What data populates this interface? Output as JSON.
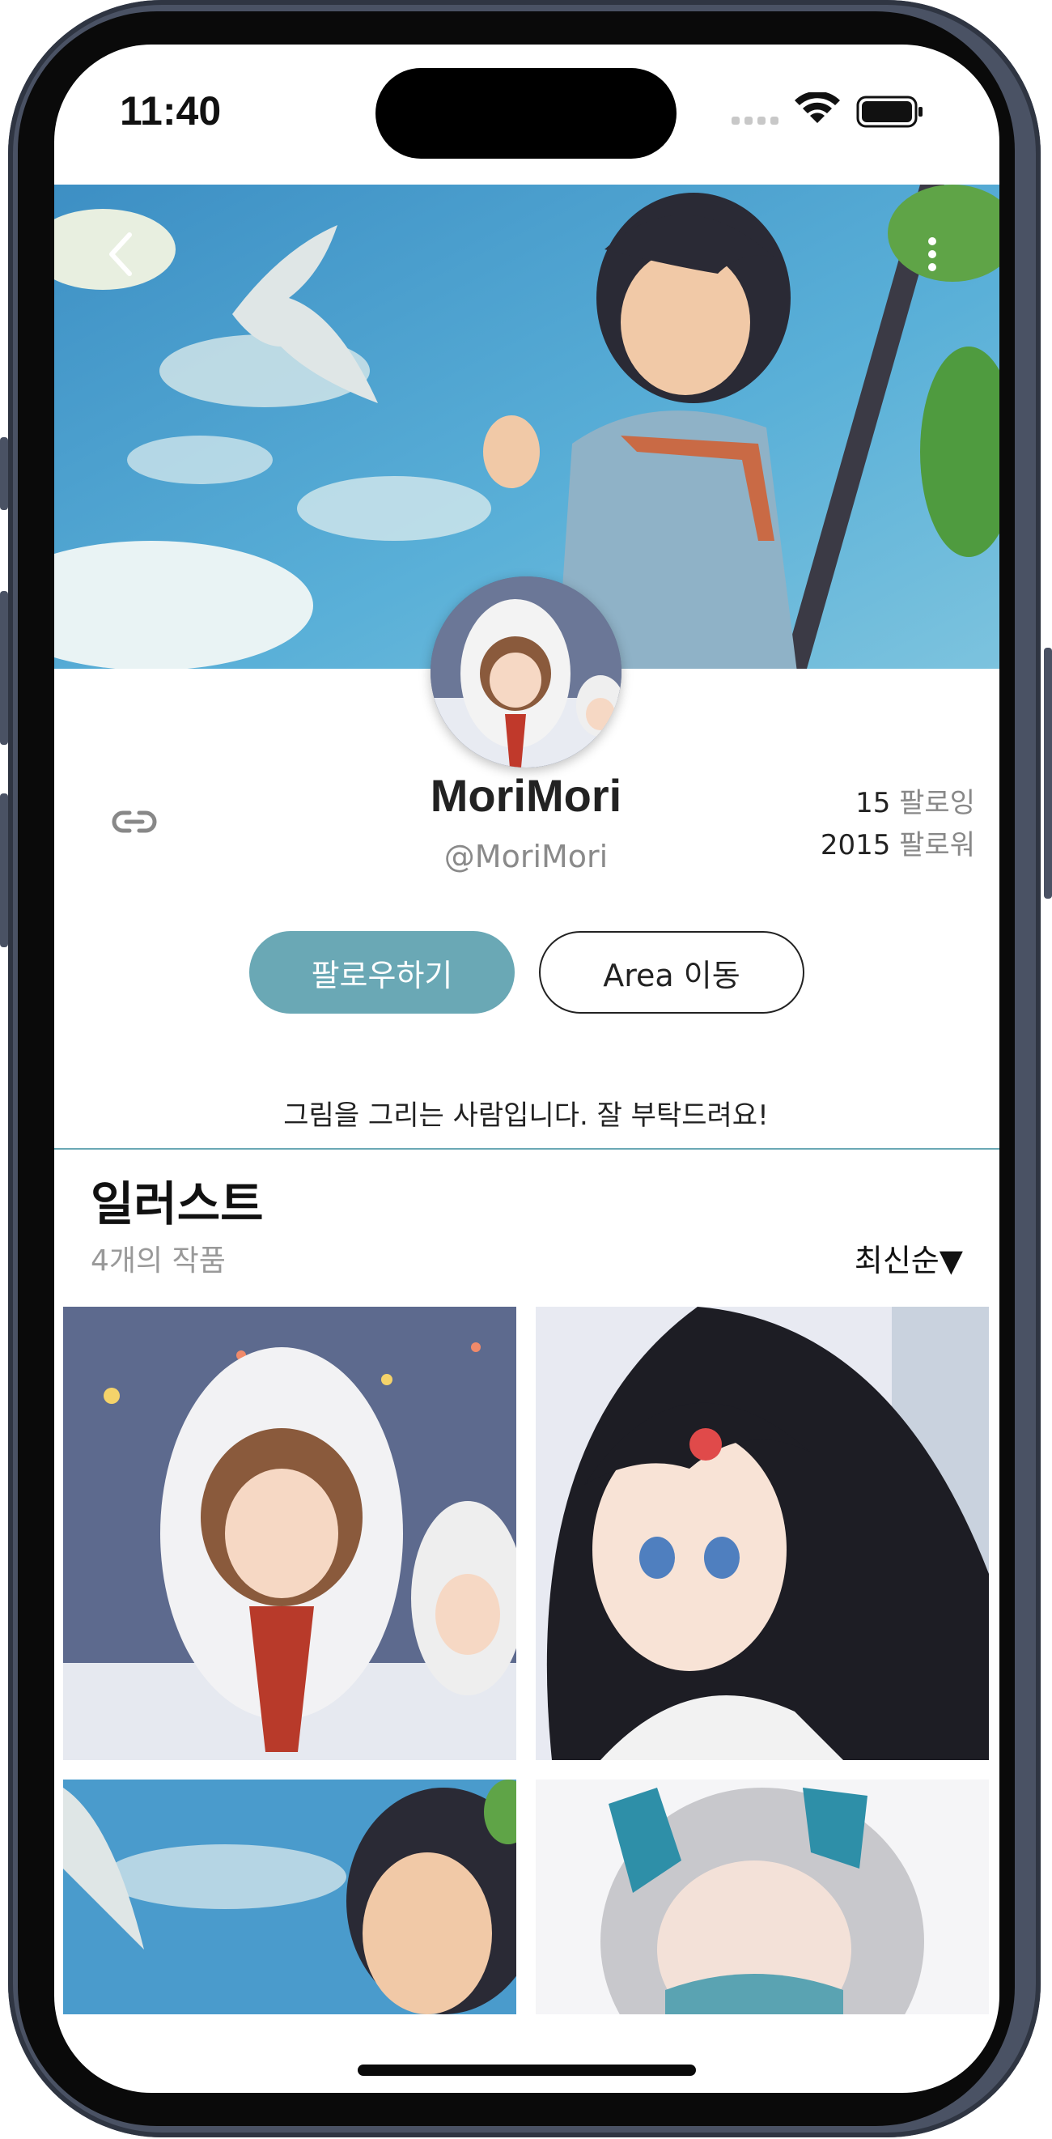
{
  "status_bar": {
    "time": "11:40"
  },
  "cover": {
    "back_icon": "chevron-left-icon",
    "more_icon": "more-vertical-icon"
  },
  "profile": {
    "name": "MoriMori",
    "handle": "@MoriMori",
    "following_count": "15",
    "following_label": "팔로잉",
    "followers_count": "2015",
    "followers_label": "팔로워",
    "link_icon": "link-icon"
  },
  "actions": {
    "follow_label": "팔로우하기",
    "area_label": "Area 이동"
  },
  "bio": "그림을 그리는 사람입니다. 잘 부탁드려요!",
  "gallery": {
    "title": "일러스트",
    "count": "4개의 작품",
    "sort": "최신순▼",
    "items": [
      "illustration-1",
      "illustration-2",
      "illustration-3",
      "illustration-4"
    ]
  },
  "colors": {
    "accent": "#6aa8b5",
    "text": "#222222",
    "muted": "#888888"
  }
}
